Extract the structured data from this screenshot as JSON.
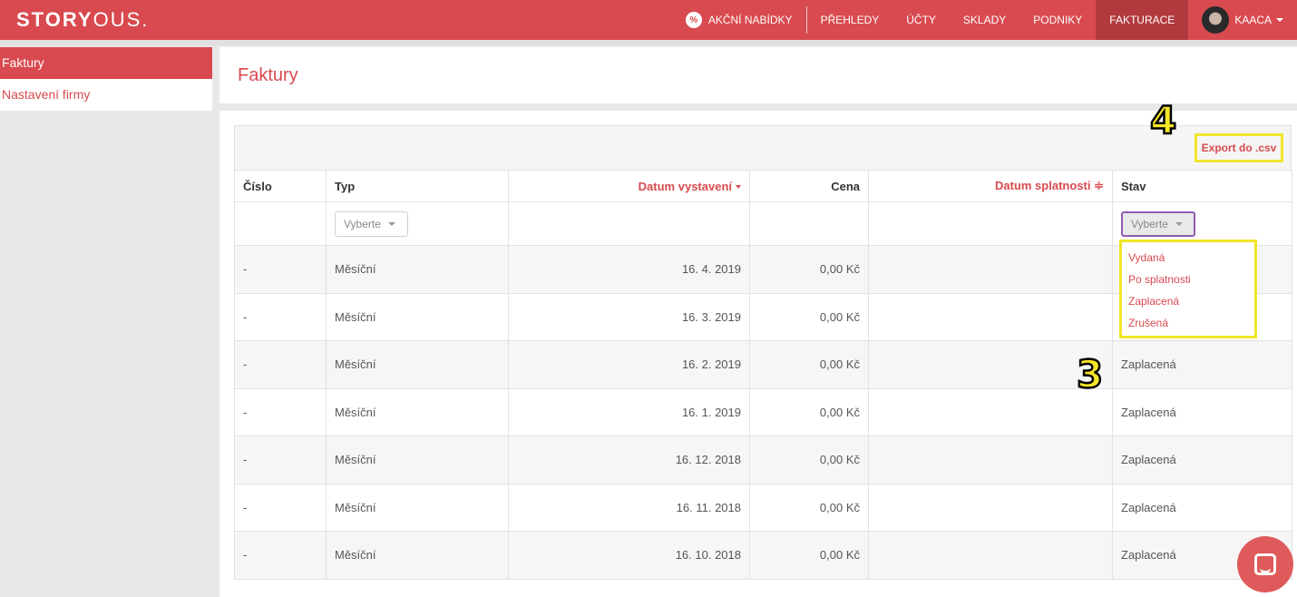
{
  "brand": {
    "bold": "STORY",
    "light": "OUS."
  },
  "nav": {
    "promo_icon_text": "%",
    "items": [
      "AKČNÍ NABÍDKY",
      "PŘEHLEDY",
      "ÚČTY",
      "SKLADY",
      "PODNIKY",
      "FAKTURACE"
    ],
    "active": "FAKTURACE",
    "user": "KAACA"
  },
  "sidebar": {
    "items": [
      {
        "label": "Faktury",
        "active": true
      },
      {
        "label": "Nastavení firmy",
        "active": false
      }
    ]
  },
  "page": {
    "title": "Faktury"
  },
  "toolbar": {
    "export_label": "Export do .csv"
  },
  "table": {
    "columns": [
      "Číslo",
      "Typ",
      "Datum vystavení",
      "Cena",
      "Datum splatnosti",
      "Stav"
    ],
    "sort_marks": {
      "datum_splatnosti": "≑"
    },
    "filters": {
      "typ_placeholder": "Vyberte",
      "stav_placeholder": "Vyberte"
    },
    "rows": [
      {
        "cislo": "-",
        "typ": "Měsíční",
        "datum_vystaveni": "16. 4. 2019",
        "cena": "0,00 Kč",
        "datum_splatnosti": "",
        "stav": ""
      },
      {
        "cislo": "-",
        "typ": "Měsíční",
        "datum_vystaveni": "16. 3. 2019",
        "cena": "0,00 Kč",
        "datum_splatnosti": "",
        "stav": ""
      },
      {
        "cislo": "-",
        "typ": "Měsíční",
        "datum_vystaveni": "16. 2. 2019",
        "cena": "0,00 Kč",
        "datum_splatnosti": "",
        "stav": "Zaplacená"
      },
      {
        "cislo": "-",
        "typ": "Měsíční",
        "datum_vystaveni": "16. 1. 2019",
        "cena": "0,00 Kč",
        "datum_splatnosti": "",
        "stav": "Zaplacená"
      },
      {
        "cislo": "-",
        "typ": "Měsíční",
        "datum_vystaveni": "16. 12. 2018",
        "cena": "0,00 Kč",
        "datum_splatnosti": "",
        "stav": "Zaplacená"
      },
      {
        "cislo": "-",
        "typ": "Měsíční",
        "datum_vystaveni": "16. 11. 2018",
        "cena": "0,00 Kč",
        "datum_splatnosti": "",
        "stav": "Zaplacená"
      },
      {
        "cislo": "-",
        "typ": "Měsíční",
        "datum_vystaveni": "16. 10. 2018",
        "cena": "0,00 Kč",
        "datum_splatnosti": "",
        "stav": "Zaplacená"
      }
    ]
  },
  "stav_dropdown": {
    "options": [
      "Vydaná",
      "Po splatnosti",
      "Zaplacená",
      "Zrušená"
    ]
  },
  "annotations": [
    "4",
    "3"
  ],
  "colors": {
    "brand": "#d84a4f",
    "highlight": "#f2e52a",
    "focus": "#8e5bb5"
  }
}
